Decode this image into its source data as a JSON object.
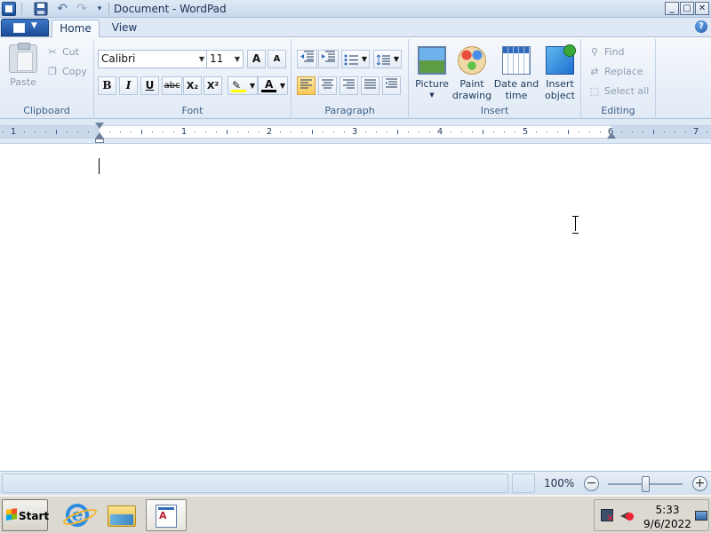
{
  "window": {
    "title": "Document - WordPad",
    "min_label": "_",
    "max_label": "□",
    "close_label": "✕"
  },
  "quick_access": {
    "undo_glyph": "↶",
    "redo_glyph": "↷",
    "more_glyph": "▾"
  },
  "tabs": {
    "home": "Home",
    "view": "View",
    "help_glyph": "?"
  },
  "clipboard": {
    "label": "Clipboard",
    "paste": "Paste",
    "cut": "Cut",
    "copy": "Copy"
  },
  "font": {
    "label": "Font",
    "family": "Calibri",
    "size": "11",
    "grow_glyph": "A",
    "shrink_glyph": "A",
    "bold_glyph": "B",
    "italic_glyph": "I",
    "underline_glyph": "U",
    "strike_glyph": "abc",
    "subscript_glyph": "X₂",
    "superscript_glyph": "X²",
    "highlight_glyph": "✎",
    "font_color_glyph": "A",
    "highlight_color": "#ffff00",
    "font_color": "#000000"
  },
  "paragraph": {
    "label": "Paragraph",
    "alignment": "left"
  },
  "insert": {
    "label": "Insert",
    "picture": "Picture",
    "paint_drawing_1": "Paint",
    "paint_drawing_2": "drawing",
    "date_time_1": "Date and",
    "date_time_2": "time",
    "insert_object_1": "Insert",
    "insert_object_2": "object"
  },
  "editing": {
    "label": "Editing",
    "find": "Find",
    "replace": "Replace",
    "select_all": "Select all"
  },
  "ruler": {
    "numbers": [
      "1",
      "1",
      "2",
      "3",
      "4",
      "5",
      "6",
      "7"
    ]
  },
  "status": {
    "zoom_level": "100%",
    "zoom_out_glyph": "−",
    "zoom_in_glyph": "+"
  },
  "taskbar": {
    "start_label": "Start",
    "time": "5:33",
    "date": "9/6/2022"
  },
  "colors": {
    "ribbon_bg": "#e1eaf6",
    "accent": "#2f6bbd",
    "active_align": "#f8c95a"
  }
}
